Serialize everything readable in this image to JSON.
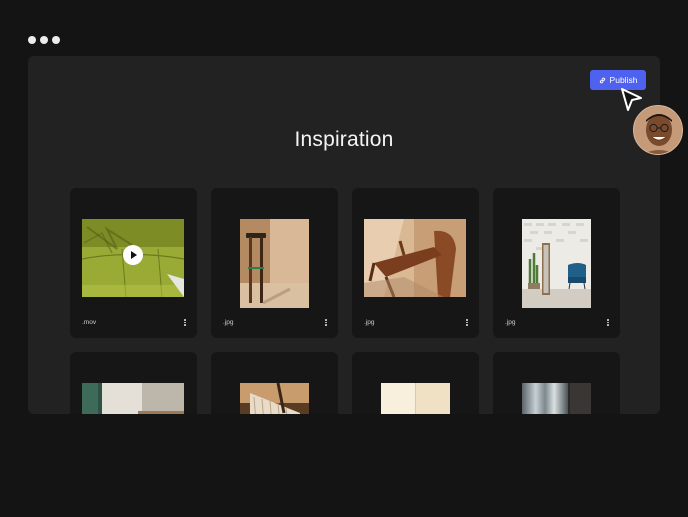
{
  "window": {
    "title": "Inspiration",
    "publish_label": "Publish"
  },
  "colors": {
    "background": "#141414",
    "panel": "#222222",
    "card": "#161616",
    "accent": "#4f62ef"
  },
  "cards": [
    {
      "ext": ".mov",
      "kind": "video",
      "icon": "play-icon"
    },
    {
      "ext": ".jpg",
      "kind": "image"
    },
    {
      "ext": ".jpg",
      "kind": "image"
    },
    {
      "ext": ".jpg",
      "kind": "image"
    },
    {
      "ext": "",
      "kind": "image"
    },
    {
      "ext": "",
      "kind": "image"
    },
    {
      "ext": "",
      "kind": "image"
    },
    {
      "ext": "",
      "kind": "image"
    }
  ]
}
